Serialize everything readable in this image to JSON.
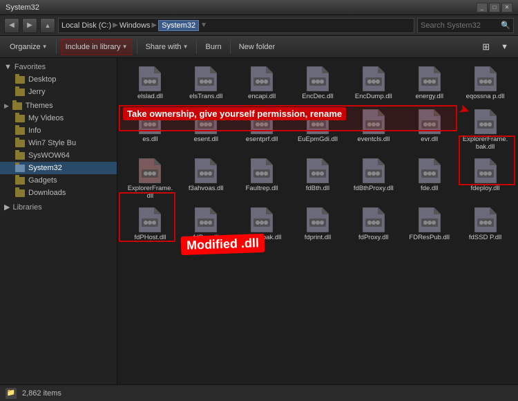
{
  "window": {
    "title": "System32",
    "controls": [
      "_",
      "□",
      "✕"
    ]
  },
  "addressbar": {
    "parts": [
      "Local Disk (C:)",
      "Windows",
      "System32"
    ],
    "search_placeholder": "Search System32"
  },
  "toolbar": {
    "organize": "Organize",
    "include_library": "Include in library",
    "share_with": "Share with",
    "burn": "Burn",
    "new_folder": "New folder"
  },
  "sidebar": {
    "favorites_label": "Favorites",
    "items_favorites": [
      "Desktop",
      "Jerry"
    ],
    "themes_label": "Themes",
    "items_main": [
      "My Videos",
      "Info",
      "Win7 Style Bu",
      "SysWOW64",
      "System32",
      "Gadgets",
      "Downloads"
    ],
    "libraries_label": "Libraries"
  },
  "files": [
    {
      "name": "elslad.dll",
      "highlighted": false
    },
    {
      "name": "elsTrans.dll",
      "highlighted": false
    },
    {
      "name": "encapi.dll",
      "highlighted": false
    },
    {
      "name": "EncDec.dll",
      "highlighted": false
    },
    {
      "name": "EncDump.dll",
      "highlighted": false
    },
    {
      "name": "energy.dll",
      "highlighted": false
    },
    {
      "name": "eqossna p.dll",
      "highlighted": false
    },
    {
      "name": "es.dll",
      "highlighted": false
    },
    {
      "name": "esent.dll",
      "highlighted": false
    },
    {
      "name": "esentprf.dll",
      "highlighted": false
    },
    {
      "name": "EuEpmGdi.dll",
      "highlighted": false
    },
    {
      "name": "eventcls.dll",
      "highlighted": false
    },
    {
      "name": "evr.dll",
      "highlighted": false
    },
    {
      "name": "ExplorerFrame.bak.dll",
      "highlighted": true
    },
    {
      "name": "ExplorerFrame.dll",
      "highlighted": true,
      "modified": true
    },
    {
      "name": "f3ahvoas.dll",
      "highlighted": false
    },
    {
      "name": "Faultrep.dll",
      "highlighted": false
    },
    {
      "name": "fdBth.dll",
      "highlighted": false
    },
    {
      "name": "fdBthProxy.dll",
      "highlighted": false
    },
    {
      "name": "fde.dll",
      "highlighted": false
    },
    {
      "name": "fdeploy.dll",
      "highlighted": false
    },
    {
      "name": "fdPHost.dll",
      "highlighted": false
    },
    {
      "name": "fdPnp.dll",
      "highlighted": false
    },
    {
      "name": "fdprint.bak.dll",
      "highlighted": false
    },
    {
      "name": "fdprint.dll",
      "highlighted": false
    },
    {
      "name": "fdProxy.dll",
      "highlighted": false
    },
    {
      "name": "FDResPub.dll",
      "highlighted": false
    },
    {
      "name": "fdSSD P.dll",
      "highlighted": false
    }
  ],
  "annotations": {
    "ownership_text": "Take ownership, give yourself permission, rename",
    "modified_text": "Modified .dll"
  },
  "status": {
    "item_count": "2,862 items"
  }
}
